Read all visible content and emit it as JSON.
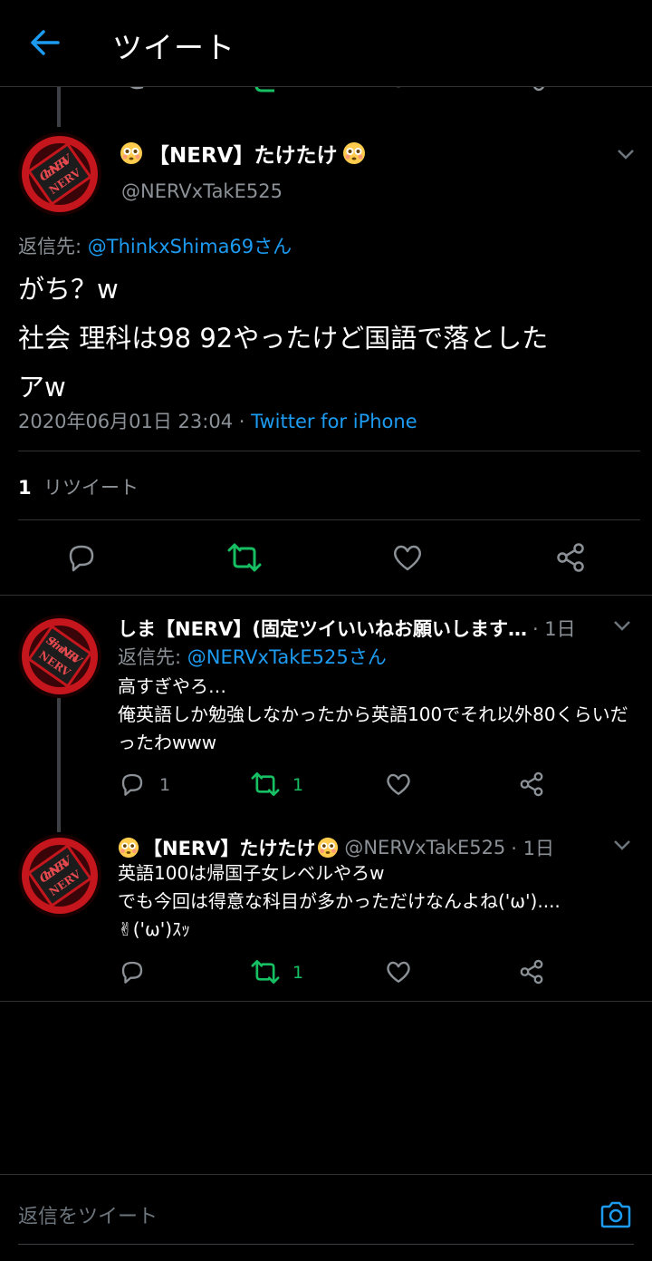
{
  "header": {
    "title": "ツイート"
  },
  "main_tweet": {
    "display_name": "【NERV】たけたけ",
    "handle": "@NERVxTakE525",
    "reply_label": "返信先: ",
    "reply_to": "@ThinkxShima69さん",
    "text_lines": [
      "がち？w",
      "社会 理科は98 92やったけど国語で落とした",
      "アw"
    ],
    "date": "2020年06月01日 23:04",
    "separator": " · ",
    "source": "Twitter for iPhone",
    "retweet_count": "1",
    "retweet_label": "リツイート"
  },
  "replies": [
    {
      "display_name": "しま【NERV】(固定ツイいいねお願いします…",
      "time": "· 1日",
      "reply_label": "返信先: ",
      "reply_to": "@NERVxTakE525さん",
      "text": "高すぎやろ…\n俺英語しか勉強しなかったから英語100でそれ以外80くらいだったわwww",
      "reply_count": "1",
      "retweet_count": "1"
    },
    {
      "display_name": "【NERV】たけたけ",
      "handle": "@NERVxTakE525",
      "time": "· 1日",
      "text": "英語100は帰国子女レベルやろw\nでも今回は得意な科目が多かっただけなんよね('ω')....\n✌('ω')ｽｯ",
      "retweet_count": "1"
    }
  ],
  "compose": {
    "placeholder": "返信をツイート"
  },
  "avatars": {
    "main": "Clan NERV",
    "shima": "Shima NERV"
  },
  "colors": {
    "accent": "#1d9bf0",
    "retweet": "#17bf63",
    "muted": "#8b9196"
  }
}
